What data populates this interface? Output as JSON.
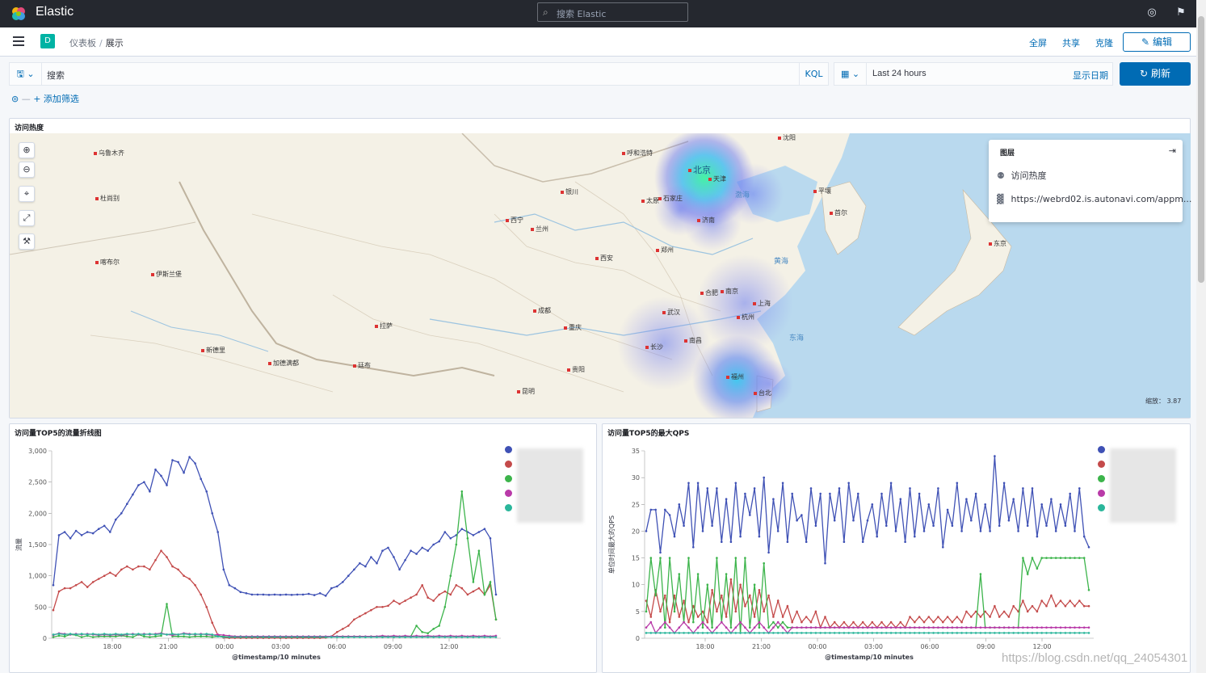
{
  "app": {
    "brand": "Elastic",
    "search_placeholder": "搜索 Elastic"
  },
  "nav": {
    "space_badge": "D",
    "breadcrumbs": [
      "仪表板",
      "展示"
    ],
    "actions": {
      "fullscreen": "全屏",
      "share": "共享",
      "clone": "克隆",
      "edit": "编辑"
    }
  },
  "query": {
    "placeholder": "搜索",
    "language": "KQL",
    "time_range": "Last 24 hours",
    "show_dates": "显示日期",
    "refresh": "刷新",
    "add_filter": "+ 添加筛选"
  },
  "map_panel": {
    "title": "访问热度",
    "layers_title": "图层",
    "layers": [
      "访问热度",
      "https://webrd02.is.autonavi.com/appm..."
    ],
    "zoom_label": "缩放：",
    "zoom_value": "3.87",
    "cities": [
      {
        "name": "乌鲁木齐"
      },
      {
        "name": "杜尚别"
      },
      {
        "name": "喀布尔"
      },
      {
        "name": "伊斯兰堡"
      },
      {
        "name": "新德里"
      },
      {
        "name": "加德满都"
      },
      {
        "name": "廷布"
      },
      {
        "name": "拉萨"
      },
      {
        "name": "西宁"
      },
      {
        "name": "兰州"
      },
      {
        "name": "银川"
      },
      {
        "name": "呼和浩特"
      },
      {
        "name": "北京"
      },
      {
        "name": "天津"
      },
      {
        "name": "石家庄"
      },
      {
        "name": "太原"
      },
      {
        "name": "济南"
      },
      {
        "name": "郑州"
      },
      {
        "name": "西安"
      },
      {
        "name": "合肥"
      },
      {
        "name": "南京"
      },
      {
        "name": "上海"
      },
      {
        "name": "杭州"
      },
      {
        "name": "武汉"
      },
      {
        "name": "成都"
      },
      {
        "name": "重庆"
      },
      {
        "name": "长沙"
      },
      {
        "name": "南昌"
      },
      {
        "name": "贵阳"
      },
      {
        "name": "昆明"
      },
      {
        "name": "福州"
      },
      {
        "name": "台北"
      },
      {
        "name": "沈阳"
      },
      {
        "name": "平壤"
      },
      {
        "name": "首尔"
      },
      {
        "name": "东京"
      }
    ],
    "seas": [
      "渤海",
      "黄海",
      "东海"
    ]
  },
  "chart_left": {
    "title": "访问量TOP5的流量折线图",
    "chart_data": {
      "type": "line",
      "xlabel": "@timestamp/10 minutes",
      "ylabel": "流量",
      "ylim": [
        0,
        3000
      ],
      "yticks": [
        "0",
        "500",
        "1,000",
        "1,500",
        "2,000",
        "2,500",
        "3,000"
      ],
      "xticks": [
        "18:00",
        "21:00",
        "00:00",
        "03:00",
        "06:00",
        "09:00",
        "12:00"
      ],
      "series": [
        {
          "color": "#3f51b5",
          "values": [
            850,
            1650,
            1700,
            1600,
            1720,
            1650,
            1700,
            1680,
            1750,
            1800,
            1700,
            1900,
            2000,
            2150,
            2300,
            2450,
            2500,
            2350,
            2700,
            2600,
            2450,
            2850,
            2820,
            2650,
            2900,
            2800,
            2550,
            2350,
            2000,
            1700,
            1100,
            850,
            800,
            740,
            720,
            700,
            700,
            700,
            695,
            700,
            695,
            700,
            695,
            700,
            700,
            710,
            690,
            720,
            680,
            800,
            830,
            900,
            1000,
            1100,
            1200,
            1150,
            1300,
            1200,
            1400,
            1450,
            1300,
            1100,
            1250,
            1400,
            1350,
            1450,
            1400,
            1500,
            1550,
            1700,
            1600,
            1650,
            1750,
            1700,
            1650,
            1700,
            1750,
            1600,
            700
          ]
        },
        {
          "color": "#c44a4a",
          "values": [
            450,
            750,
            800,
            800,
            850,
            900,
            820,
            900,
            950,
            1000,
            1050,
            1000,
            1100,
            1150,
            1100,
            1150,
            1150,
            1100,
            1250,
            1400,
            1300,
            1150,
            1100,
            1000,
            950,
            850,
            700,
            500,
            250,
            50,
            10,
            5,
            5,
            5,
            5,
            5,
            5,
            5,
            5,
            5,
            5,
            5,
            5,
            5,
            5,
            5,
            5,
            5,
            10,
            30,
            100,
            150,
            200,
            300,
            350,
            400,
            450,
            500,
            500,
            520,
            600,
            550,
            600,
            650,
            700,
            850,
            650,
            600,
            700,
            750,
            700,
            850,
            800,
            700,
            750,
            800,
            700,
            850,
            300
          ]
        },
        {
          "color": "#3cb44b",
          "values": [
            20,
            40,
            30,
            60,
            50,
            20,
            40,
            20,
            30,
            30,
            30,
            30,
            40,
            30,
            20,
            60,
            30,
            20,
            30,
            40,
            550,
            30,
            30,
            30,
            20,
            30,
            30,
            30,
            20,
            30,
            30,
            20,
            30,
            30,
            20,
            30,
            30,
            20,
            30,
            30,
            20,
            30,
            20,
            30,
            20,
            30,
            20,
            30,
            20,
            30,
            30,
            20,
            30,
            30,
            30,
            20,
            30,
            30,
            20,
            30,
            20,
            30,
            20,
            30,
            200,
            100,
            80,
            150,
            200,
            500,
            1000,
            1500,
            2350,
            1600,
            900,
            1400,
            700,
            900,
            300
          ]
        },
        {
          "color": "#b93aa8",
          "values": [
            50,
            80,
            70,
            60,
            70,
            60,
            70,
            60,
            50,
            60,
            50,
            60,
            50,
            60,
            70,
            60,
            70,
            60,
            70,
            80,
            60,
            50,
            60,
            80,
            70,
            60,
            70,
            60,
            50,
            60,
            50,
            40,
            30,
            30,
            30,
            30,
            30,
            30,
            30,
            30,
            30,
            30,
            30,
            30,
            30,
            30,
            30,
            30,
            30,
            30,
            30,
            30,
            30,
            30,
            30,
            30,
            30,
            30,
            40,
            30,
            40,
            30,
            40,
            30,
            40,
            30,
            40,
            30,
            40,
            30,
            40,
            30,
            40,
            30,
            40,
            30,
            40,
            30,
            40
          ]
        },
        {
          "color": "#2ab69b",
          "values": [
            60,
            70,
            60,
            70,
            60,
            70,
            60,
            70,
            60,
            70,
            60,
            70,
            60,
            70,
            60,
            70,
            60,
            70,
            60,
            70,
            60,
            70,
            60,
            70,
            60,
            70,
            60,
            70,
            60,
            30,
            20,
            20,
            20,
            20,
            20,
            20,
            20,
            20,
            20,
            20,
            20,
            20,
            20,
            20,
            20,
            20,
            20,
            20,
            20,
            20,
            20,
            20,
            20,
            20,
            20,
            20,
            20,
            20,
            20,
            20,
            20,
            20,
            20,
            20,
            20,
            20,
            20,
            20,
            20,
            20,
            20,
            20,
            20,
            20,
            20,
            20,
            20,
            20,
            20
          ]
        }
      ]
    }
  },
  "chart_right": {
    "title": "访问量TOP5的最大QPS",
    "chart_data": {
      "type": "line",
      "xlabel": "@timestamp/10 minutes",
      "ylabel": "单位时间最大的QPS",
      "ylim": [
        0,
        35
      ],
      "yticks": [
        "0",
        "5",
        "10",
        "15",
        "20",
        "25",
        "30",
        "35"
      ],
      "xticks": [
        "18:00",
        "21:00",
        "00:00",
        "03:00",
        "06:00",
        "09:00",
        "12:00"
      ],
      "series": [
        {
          "color": "#3f51b5",
          "values": [
            20,
            24,
            24,
            16,
            24,
            23,
            19,
            25,
            21,
            29,
            17,
            29,
            20,
            28,
            21,
            28,
            18,
            26,
            18,
            29,
            19,
            27,
            23,
            28,
            19,
            30,
            16,
            26,
            20,
            29,
            18,
            27,
            22,
            23,
            18,
            28,
            21,
            27,
            14,
            27,
            22,
            28,
            18,
            29,
            22,
            27,
            18,
            22,
            25,
            19,
            27,
            21,
            29,
            20,
            26,
            18,
            28,
            19,
            27,
            20,
            25,
            21,
            28,
            17,
            24,
            21,
            29,
            20,
            26,
            22,
            27,
            20,
            25,
            20,
            34,
            21,
            29,
            22,
            26,
            20,
            28,
            21,
            28,
            19,
            25,
            21,
            26,
            20,
            25,
            21,
            27,
            20,
            28,
            19,
            17
          ]
        },
        {
          "color": "#c44a4a",
          "values": [
            7,
            4,
            9,
            5,
            8,
            3,
            8,
            4,
            7,
            3,
            6,
            4,
            5,
            3,
            9,
            5,
            8,
            4,
            11,
            5,
            10,
            6,
            8,
            4,
            9,
            5,
            8,
            4,
            7,
            4,
            6,
            3,
            5,
            3,
            4,
            3,
            5,
            2,
            4,
            2,
            3,
            2,
            3,
            2,
            3,
            2,
            3,
            2,
            3,
            2,
            3,
            2,
            3,
            2,
            3,
            2,
            4,
            3,
            4,
            3,
            4,
            3,
            4,
            3,
            4,
            3,
            4,
            3,
            5,
            4,
            5,
            4,
            5,
            4,
            6,
            4,
            5,
            4,
            6,
            5,
            7,
            5,
            6,
            5,
            7,
            6,
            8,
            6,
            7,
            6,
            7,
            6,
            7,
            6,
            6
          ]
        },
        {
          "color": "#3cb44b",
          "values": [
            5,
            15,
            8,
            15,
            2,
            15,
            5,
            12,
            3,
            15,
            3,
            12,
            2,
            10,
            2,
            15,
            3,
            12,
            2,
            15,
            1,
            15,
            2,
            10,
            2,
            14,
            2,
            3,
            2,
            3,
            2,
            2,
            2,
            2,
            2,
            2,
            2,
            2,
            2,
            2,
            2,
            2,
            2,
            2,
            2,
            2,
            2,
            2,
            2,
            2,
            2,
            2,
            2,
            2,
            2,
            2,
            2,
            2,
            2,
            2,
            2,
            2,
            2,
            2,
            2,
            2,
            2,
            2,
            2,
            2,
            2,
            12,
            2,
            2,
            2,
            2,
            2,
            2,
            2,
            2,
            15,
            12,
            15,
            13,
            15,
            15,
            15,
            15,
            15,
            15,
            15,
            15,
            15,
            15,
            9
          ]
        },
        {
          "color": "#b93aa8",
          "values": [
            2,
            3,
            1,
            2,
            3,
            2,
            1,
            2,
            3,
            2,
            1,
            2,
            3,
            2,
            1,
            2,
            3,
            2,
            1,
            2,
            3,
            2,
            1,
            2,
            3,
            2,
            1,
            2,
            3,
            2,
            1,
            2,
            2,
            2,
            2,
            2,
            2,
            2,
            2,
            2,
            2,
            2,
            2,
            2,
            2,
            2,
            2,
            2,
            2,
            2,
            2,
            2,
            2,
            2,
            2,
            2,
            2,
            2,
            2,
            2,
            2,
            2,
            2,
            2,
            2,
            2,
            2,
            2,
            2,
            2,
            2,
            2,
            2,
            2,
            2,
            2,
            2,
            2,
            2,
            2,
            2,
            2,
            2,
            2,
            2,
            2,
            2,
            2,
            2,
            2,
            2,
            2,
            2,
            2,
            2
          ]
        },
        {
          "color": "#2ab69b",
          "values": [
            1,
            1,
            1,
            1,
            1,
            1,
            1,
            1,
            1,
            1,
            1,
            1,
            1,
            1,
            1,
            1,
            1,
            1,
            1,
            1,
            1,
            1,
            1,
            1,
            1,
            1,
            1,
            1,
            1,
            1,
            1,
            1,
            1,
            1,
            1,
            1,
            1,
            1,
            1,
            1,
            1,
            1,
            1,
            1,
            1,
            1,
            1,
            1,
            1,
            1,
            1,
            1,
            1,
            1,
            1,
            1,
            1,
            1,
            1,
            1,
            1,
            1,
            1,
            1,
            1,
            1,
            1,
            1,
            1,
            1,
            1,
            1,
            1,
            1,
            1,
            1,
            1,
            1,
            1,
            1,
            1,
            1,
            1,
            1,
            1,
            1,
            1,
            1,
            1,
            1,
            1,
            1,
            1,
            1,
            1
          ]
        }
      ]
    }
  },
  "watermark": "https://blog.csdn.net/qq_24054301",
  "colors": {
    "accent": "#006bb4",
    "topbar": "#25282f",
    "badge": "#00b3a4"
  }
}
